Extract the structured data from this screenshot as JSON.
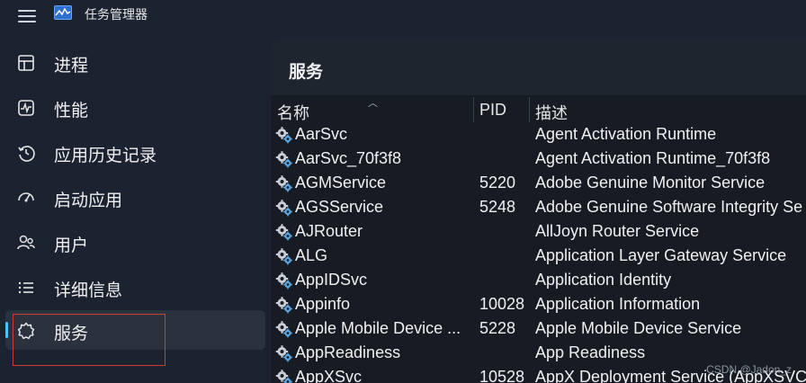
{
  "app": {
    "title": "任务管理器",
    "menu_icon": "hamburger-icon",
    "logo_icon": "task-manager-logo-icon"
  },
  "sidebar": {
    "items": [
      {
        "label": "进程",
        "icon": "processes-icon"
      },
      {
        "label": "性能",
        "icon": "performance-icon"
      },
      {
        "label": "应用历史记录",
        "icon": "history-icon"
      },
      {
        "label": "启动应用",
        "icon": "startup-icon"
      },
      {
        "label": "用户",
        "icon": "users-icon"
      },
      {
        "label": "详细信息",
        "icon": "details-icon"
      },
      {
        "label": "服务",
        "icon": "services-icon",
        "active": true
      }
    ]
  },
  "main": {
    "title": "服务",
    "columns": {
      "name": "名称",
      "pid": "PID",
      "description": "描述"
    },
    "sorted_by": "name",
    "rows": [
      {
        "name": "AarSvc",
        "pid": "",
        "description": "Agent Activation Runtime"
      },
      {
        "name": "AarSvc_70f3f8",
        "pid": "",
        "description": "Agent Activation Runtime_70f3f8"
      },
      {
        "name": "AGMService",
        "pid": "5220",
        "description": "Adobe Genuine Monitor Service"
      },
      {
        "name": "AGSService",
        "pid": "5248",
        "description": "Adobe Genuine Software Integrity Se"
      },
      {
        "name": "AJRouter",
        "pid": "",
        "description": "AllJoyn Router Service"
      },
      {
        "name": "ALG",
        "pid": "",
        "description": "Application Layer Gateway Service"
      },
      {
        "name": "AppIDSvc",
        "pid": "",
        "description": "Application Identity"
      },
      {
        "name": "Appinfo",
        "pid": "10028",
        "description": "Application Information"
      },
      {
        "name": "Apple Mobile Device ...",
        "pid": "5228",
        "description": "Apple Mobile Device Service"
      },
      {
        "name": "AppReadiness",
        "pid": "",
        "description": "App Readiness"
      },
      {
        "name": "AppXSvc",
        "pid": "10528",
        "description": "AppX Deployment Service (AppXSVC"
      }
    ]
  },
  "watermark": "CSDN @Jadon_z",
  "colors": {
    "accent": "#4cc2ff",
    "highlight_border": "#d23a3a",
    "background": "#1c2330"
  }
}
